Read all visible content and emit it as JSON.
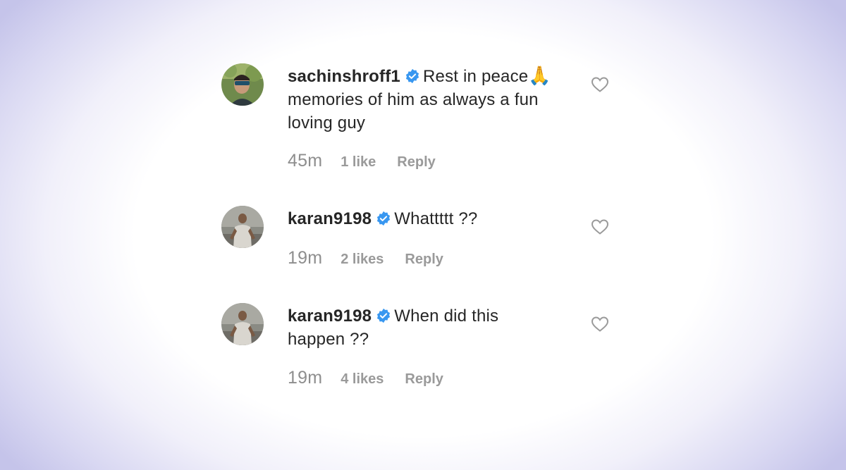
{
  "comments": [
    {
      "username": "sachinshroff1",
      "verified": true,
      "text": "Rest in peace",
      "emoji": "🙏",
      "text_continued": "memories of him as always a fun loving guy",
      "time": "45m",
      "likes": "1 like",
      "reply_label": "Reply",
      "like_icon": "heart-outline-icon"
    },
    {
      "username": "karan9198",
      "verified": true,
      "text": "Whattttt ??",
      "time": "19m",
      "likes": "2 likes",
      "reply_label": "Reply",
      "like_icon": "heart-outline-icon"
    },
    {
      "username": "karan9198",
      "verified": true,
      "text": "When did this happen ??",
      "time": "19m",
      "likes": "4 likes",
      "reply_label": "Reply",
      "like_icon": "heart-outline-icon"
    }
  ],
  "colors": {
    "verified_badge": "#3897f0",
    "text": "#262626",
    "meta": "#8e8e8e",
    "background_edge": "#c5c4ea"
  }
}
